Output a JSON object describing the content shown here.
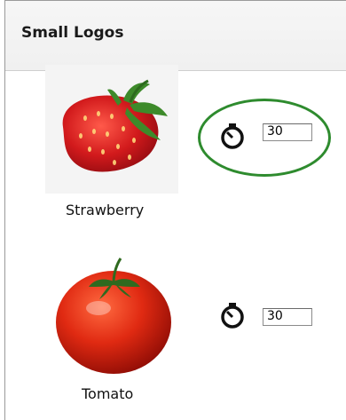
{
  "panel": {
    "title": "Small Logos"
  },
  "items": [
    {
      "name": "Strawberry",
      "icon": "timer-icon",
      "timer_value": "30"
    },
    {
      "name": "Tomato",
      "icon": "timer-icon",
      "timer_value": "30"
    }
  ],
  "colors": {
    "highlight_ring": "#2e8b2e",
    "header_bg": "#f3f3f3"
  }
}
